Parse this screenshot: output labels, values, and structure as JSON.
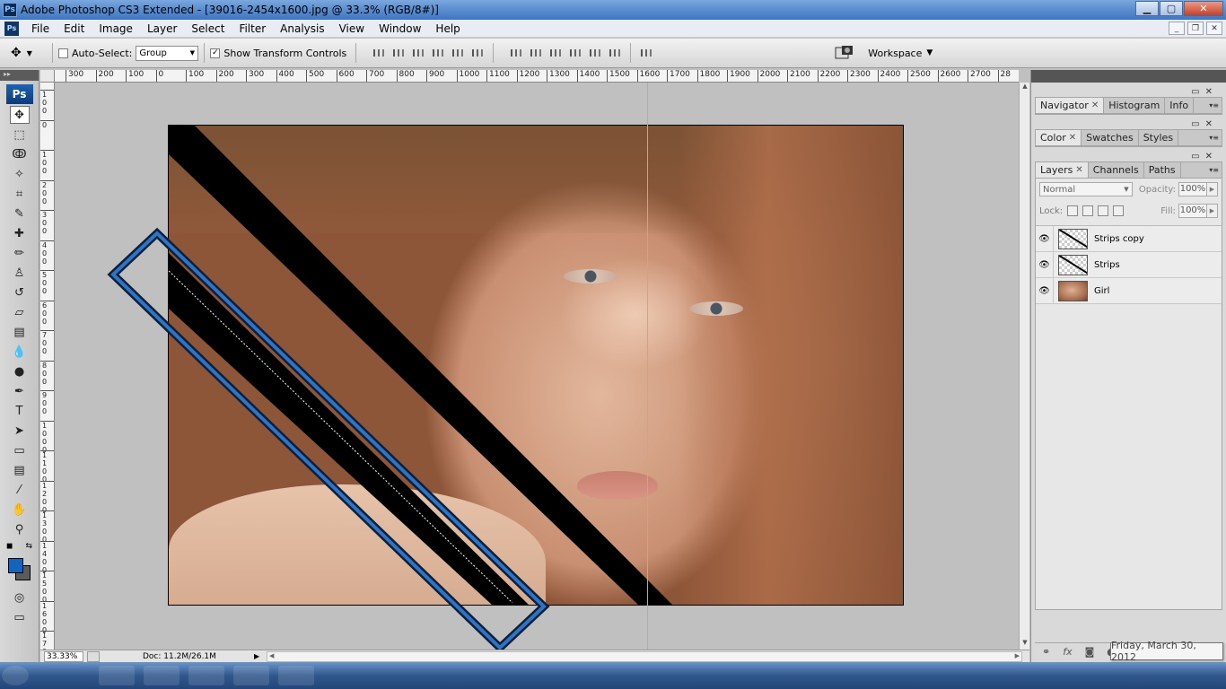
{
  "app": {
    "title": "Adobe Photoshop CS3 Extended - [39016-2454x1600.jpg @ 33.3% (RGB/8#)]",
    "logo": "Ps"
  },
  "window_buttons": [
    "minimize-icon",
    "maximize-icon",
    "close-icon"
  ],
  "menu": [
    "File",
    "Edit",
    "Image",
    "Layer",
    "Select",
    "Filter",
    "Analysis",
    "View",
    "Window",
    "Help"
  ],
  "options": {
    "auto_select_label": "Auto-Select:",
    "auto_select_checked": false,
    "auto_select_value": "Group",
    "show_transform_label": "Show Transform Controls",
    "show_transform_checked": true,
    "workspace_label": "Workspace"
  },
  "rulers": {
    "top": [
      "300",
      "200",
      "100",
      "0",
      "100",
      "200",
      "300",
      "400",
      "500",
      "600",
      "700",
      "800",
      "900",
      "1000",
      "1100",
      "1200",
      "1300",
      "1400",
      "1500",
      "1600",
      "1700",
      "1800",
      "1900",
      "2000",
      "2100",
      "2200",
      "2300",
      "2400",
      "2500",
      "2600",
      "2700",
      "28"
    ],
    "left": [
      "1 0 0",
      "0",
      "1 0 0",
      "2 0 0",
      "3 0 0",
      "4 0 0",
      "5 0 0",
      "6 0 0",
      "7 0 0",
      "8 0 0",
      "9 0 0",
      "1 0 0 0",
      "1 1 0 0",
      "1 2 0 0",
      "1 3 0 0",
      "1 4 0 0",
      "1 5 0 0",
      "1 6 0 0",
      "1 7 0 0"
    ]
  },
  "toolbar": {
    "logo": "Ps",
    "tools": [
      {
        "name": "move-tool",
        "glyph": "✥"
      },
      {
        "name": "marquee-tool",
        "glyph": "⬚"
      },
      {
        "name": "lasso-tool",
        "glyph": "ↂ"
      },
      {
        "name": "magic-wand-tool",
        "glyph": "✧"
      },
      {
        "name": "crop-tool",
        "glyph": "⌗"
      },
      {
        "name": "slice-tool",
        "glyph": "✎"
      },
      {
        "name": "healing-brush-tool",
        "glyph": "✚"
      },
      {
        "name": "brush-tool",
        "glyph": "✏"
      },
      {
        "name": "clone-stamp-tool",
        "glyph": "♙"
      },
      {
        "name": "history-brush-tool",
        "glyph": "↺"
      },
      {
        "name": "eraser-tool",
        "glyph": "▱"
      },
      {
        "name": "gradient-tool",
        "glyph": "▤"
      },
      {
        "name": "blur-tool",
        "glyph": "💧"
      },
      {
        "name": "dodge-tool",
        "glyph": "●"
      },
      {
        "name": "pen-tool",
        "glyph": "✒"
      },
      {
        "name": "type-tool",
        "glyph": "T"
      },
      {
        "name": "path-selection-tool",
        "glyph": "➤"
      },
      {
        "name": "shape-tool",
        "glyph": "▭"
      },
      {
        "name": "notes-tool",
        "glyph": "▤"
      },
      {
        "name": "eyedropper-tool",
        "glyph": "⁄"
      },
      {
        "name": "hand-tool",
        "glyph": "✋"
      },
      {
        "name": "zoom-tool",
        "glyph": "⚲"
      }
    ],
    "foreground_color": "#1464b9",
    "background_color": "#5b5b5b"
  },
  "status": {
    "zoom": "33.33%",
    "doc": "Doc: 11.2M/26.1M"
  },
  "panels": {
    "group1_tabs": [
      "Navigator",
      "Histogram",
      "Info"
    ],
    "group2_tabs": [
      "Color",
      "Swatches",
      "Styles"
    ],
    "layers_tabs": [
      "Layers",
      "Channels",
      "Paths"
    ],
    "blend_mode": "Normal",
    "opacity_label": "Opacity:",
    "opacity_value": "100%",
    "lock_label": "Lock:",
    "fill_label": "Fill:",
    "fill_value": "100%",
    "layers": [
      {
        "name": "Strips copy",
        "thumb": "strip"
      },
      {
        "name": "Strips",
        "thumb": "strip"
      },
      {
        "name": "Girl",
        "thumb": "photo"
      }
    ]
  },
  "taskbar": {
    "date_tooltip": "Friday, March 30, 2012"
  }
}
